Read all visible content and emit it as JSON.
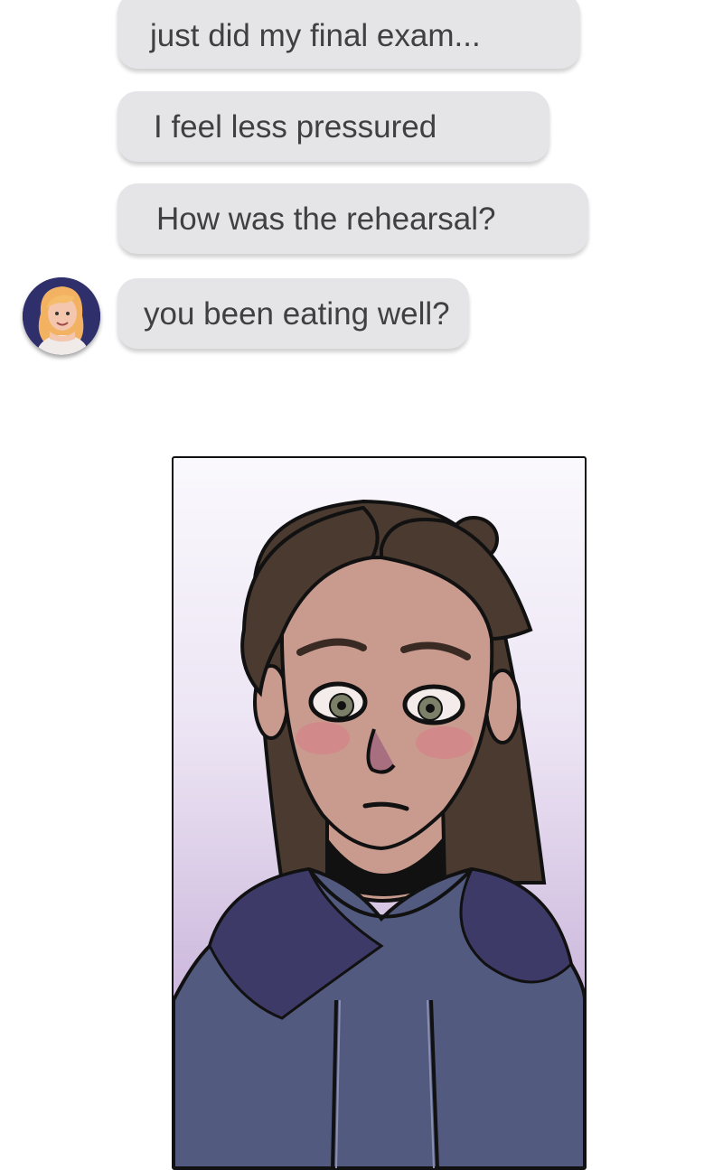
{
  "messages": [
    {
      "text": "just did my final exam...",
      "sender": "other"
    },
    {
      "text": "I feel less pressured",
      "sender": "other"
    },
    {
      "text": "How was the rehearsal?",
      "sender": "other"
    },
    {
      "text": "you been eating well?",
      "sender": "other"
    }
  ],
  "avatar": {
    "icon": "blonde-woman-avatar-icon"
  },
  "panel": {
    "illustration": "worried-woman-in-hoodie-comic-panel"
  },
  "colors": {
    "bubble_bg": "#e5e5e8",
    "bubble_text": "#404040",
    "page_bg": "#ffffff",
    "avatar_bg": "#2e2f6b",
    "panel_gradient_top": "#faf9fd",
    "panel_gradient_bottom": "#bba5d3",
    "hoodie": "#525a80",
    "hair": "#4a3a30",
    "skin": "#c99a8e"
  }
}
